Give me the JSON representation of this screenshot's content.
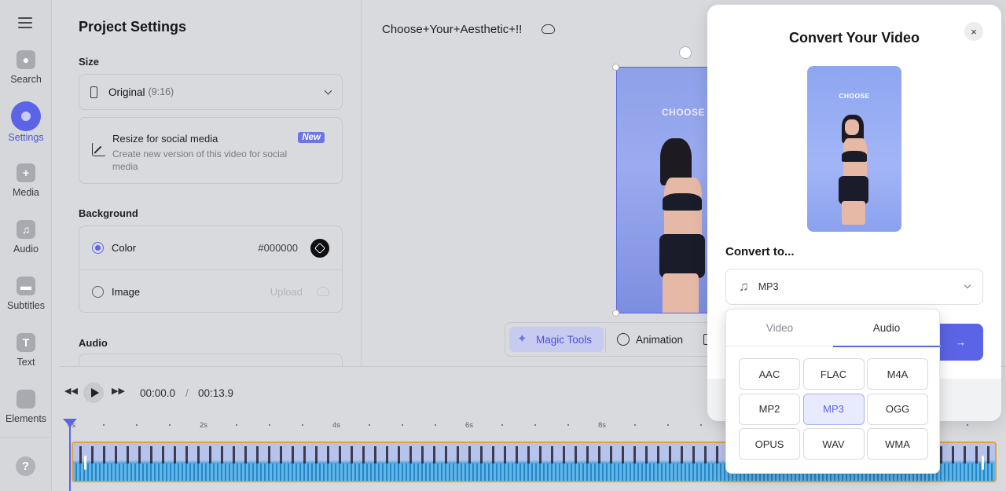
{
  "rail": {
    "items": [
      {
        "label": "Search",
        "icon": "search-icon"
      },
      {
        "label": "Settings",
        "icon": "settings-icon",
        "active": true
      },
      {
        "label": "Media",
        "icon": "plus-icon"
      },
      {
        "label": "Audio",
        "icon": "music-note-icon"
      },
      {
        "label": "Subtitles",
        "icon": "subtitles-icon"
      },
      {
        "label": "Text",
        "icon": "text-icon"
      },
      {
        "label": "Elements",
        "icon": "elements-icon"
      }
    ],
    "help": "?"
  },
  "settings": {
    "title": "Project Settings",
    "size_label": "Size",
    "size_value": "Original",
    "size_ratio": "(9:16)",
    "resize_title": "Resize for social media",
    "resize_desc": "Create new version of this video for social media",
    "resize_badge": "New",
    "background_label": "Background",
    "bg_color_label": "Color",
    "bg_color_value": "#000000",
    "bg_image_label": "Image",
    "bg_image_action": "Upload",
    "audio_label": "Audio"
  },
  "canvas": {
    "project_title": "Choose+Your+Aesthetic+!!",
    "overlay_text": "CHOOSE"
  },
  "toolbar": {
    "magic_label": "Magic Tools",
    "animation_label": "Animation"
  },
  "timeline": {
    "current_time": "00:00.0",
    "separator": "/",
    "total_time": "00:13.9",
    "ticks": [
      "0s",
      "2s",
      "4s",
      "6s",
      "8s"
    ]
  },
  "modal": {
    "title": "Convert Your Video",
    "close": "×",
    "preview_text": "CHOOSE",
    "convert_label": "Convert to...",
    "selected_format": "MP3",
    "convert_arrow": "→"
  },
  "dropdown": {
    "tabs": [
      {
        "label": "Video",
        "active": false
      },
      {
        "label": "Audio",
        "active": true
      }
    ],
    "formats": [
      "AAC",
      "FLAC",
      "M4A",
      "MP2",
      "MP3",
      "OGG",
      "OPUS",
      "WAV",
      "WMA"
    ],
    "selected": "MP3"
  },
  "colors": {
    "accent": "#5b63e6",
    "panel_bg": "#d9dadd",
    "clip_border": "#e2a23c"
  }
}
